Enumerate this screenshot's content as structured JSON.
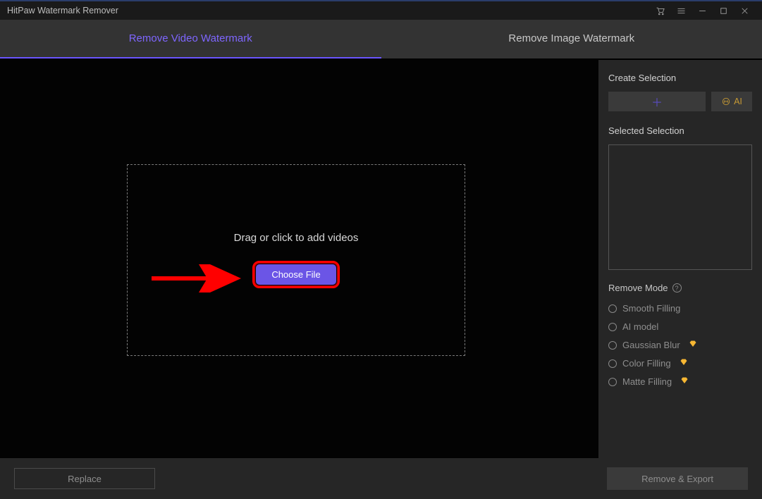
{
  "titlebar": {
    "title": "HitPaw Watermark Remover"
  },
  "tabs": {
    "video": "Remove Video Watermark",
    "image": "Remove Image Watermark"
  },
  "dropzone": {
    "text": "Drag or click to add videos",
    "button": "Choose File"
  },
  "sidepanel": {
    "create_label": "Create Selection",
    "ai_label": "AI",
    "selected_label": "Selected Selection",
    "mode_label": "Remove Mode",
    "modes": {
      "smooth": "Smooth Filling",
      "ai": "AI model",
      "gaussian": "Gaussian Blur",
      "color": "Color Filling",
      "matte": "Matte Filling"
    }
  },
  "bottom": {
    "replace": "Replace",
    "export": "Remove & Export"
  }
}
